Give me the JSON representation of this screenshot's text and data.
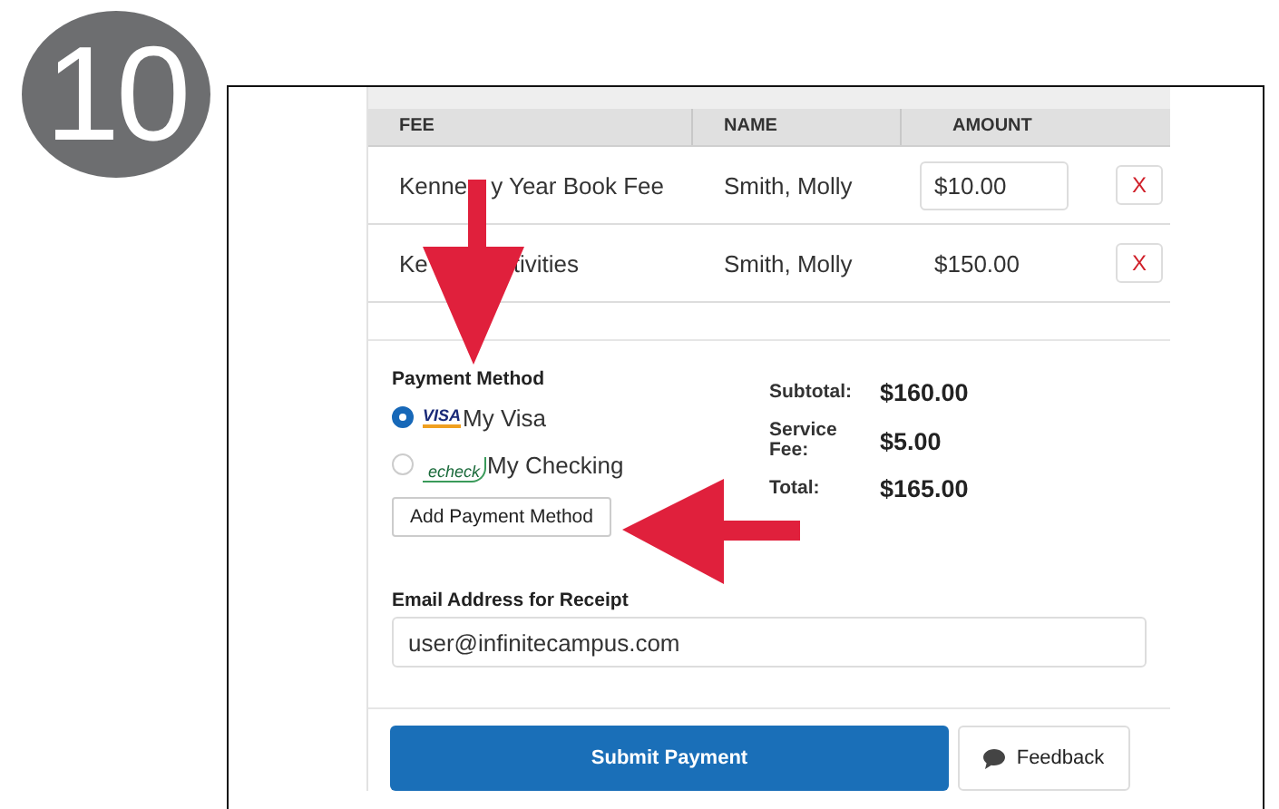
{
  "step": "10",
  "table": {
    "columns": [
      "FEE",
      "NAME",
      "AMOUNT"
    ],
    "rows": [
      {
        "fee": [
          "Kenne",
          "y Year Book Fee"
        ],
        "name": "Smith, Molly",
        "amount": "$10.00",
        "editable": true,
        "remove": "X"
      },
      {
        "fee": [
          "Ke",
          "tivities"
        ],
        "name": "Smith, Molly",
        "amount": "$150.00",
        "editable": false,
        "remove": "X"
      }
    ]
  },
  "payment": {
    "title": "Payment Method",
    "methods": [
      {
        "kind": "visa",
        "logo": "VISA",
        "label": "My Visa",
        "selected": true
      },
      {
        "kind": "echeck",
        "logo": "echeck",
        "label": "My Checking",
        "selected": false
      }
    ],
    "add_button": "Add Payment Method",
    "summary": [
      {
        "label": "Subtotal:",
        "value": "$160.00"
      },
      {
        "label": "Service Fee:",
        "value": "$5.00"
      },
      {
        "label": "Total:",
        "value": "$165.00"
      }
    ]
  },
  "email": {
    "label": "Email Address for Receipt",
    "value": "user@infinitecampus.com"
  },
  "buttons": {
    "submit": "Submit Payment",
    "feedback": "Feedback"
  }
}
